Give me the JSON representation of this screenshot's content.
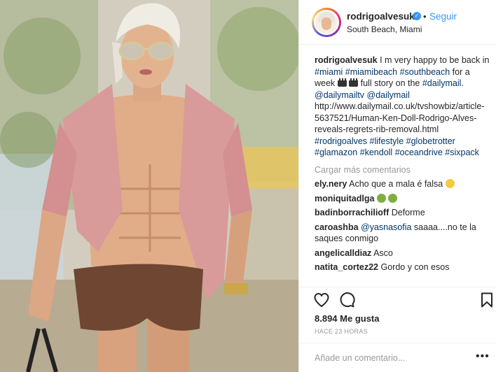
{
  "post": {
    "image_alt": "Photo of a shirtless man in pink shirt and brown shorts walking on a sunny street",
    "icons": [
      "heart-icon",
      "comment-icon",
      "bookmark-icon",
      "more-icon",
      "verified-icon"
    ]
  },
  "header": {
    "username": "rodrigoalvesuk",
    "verified_glyph": "✓",
    "separator": "•",
    "follow_label": "Seguir",
    "location": "South Beach, Miami"
  },
  "caption": {
    "username": "rodrigoalvesuk",
    "text_1": " I m very happy to be back in ",
    "tag_miami": "#miami",
    "tag_miamibeach": "#miamibeach",
    "tag_southbeach": "#southbeach",
    "text_2": " for a week ",
    "text_3": " full story on the ",
    "tag_dailymail": "#dailymail",
    "text_4": ". ",
    "mention_dailymailtv": "@dailymailtv",
    "mention_dailymail": "@dailymail",
    "url": " http://www.dailymail.co.uk/tvshowbiz/article-5637521/Human-Ken-Doll-Rodrigo-Alves-reveals-regrets-rib-removal.html ",
    "tag_rodrigoalves": "#rodrigoalves",
    "tag_lifestyle": "#lifestyle",
    "tag_globetrotter": "#globetrotter",
    "tag_glamazon": "#glamazon",
    "tag_kendoll": "#kendoll",
    "tag_oceandrive": "#oceandrive",
    "tag_sixpack": "#sixpack"
  },
  "load_more_label": "Cargar más comentarios",
  "comments": [
    {
      "user": "ely.nery",
      "text": " Acho que a mala é falsa"
    },
    {
      "user": "moniquitadlga",
      "text": " "
    },
    {
      "user": "badinborrachilioff",
      "text": " Deforme"
    },
    {
      "user": "caroashba",
      "mention": " @yasnasofia",
      "text": " saaaa....no te la saques conmigo"
    },
    {
      "user": "angelicalldiaz",
      "text": " Asco"
    },
    {
      "user": "natita_cortez22",
      "text": " Gordo y con esos"
    }
  ],
  "likes": "8.894 Me gusta",
  "timestamp": "HACE 23 HORAS",
  "comment_input": {
    "placeholder": "Añade un comentario...",
    "value": ""
  },
  "more_label": "•••",
  "colors": {
    "accent": "#3897f0",
    "hashtag": "#003569",
    "muted": "#999999",
    "text": "#262626"
  }
}
